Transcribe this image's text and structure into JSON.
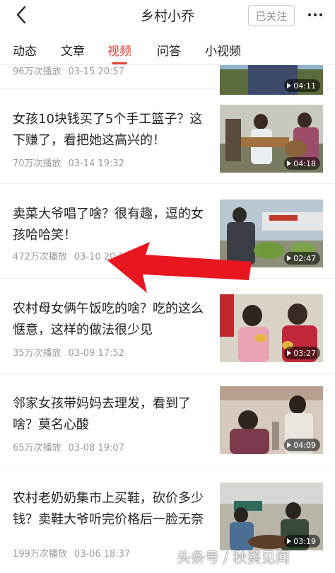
{
  "header": {
    "title": "乡村小乔",
    "follow_label": "已关注"
  },
  "tabs": [
    {
      "label": "动态",
      "active": false
    },
    {
      "label": "文章",
      "active": false
    },
    {
      "label": "视频",
      "active": true
    },
    {
      "label": "问答",
      "active": false
    },
    {
      "label": "小视频",
      "active": false
    }
  ],
  "accent_color": "#e8453c",
  "videos": [
    {
      "title": "",
      "views": "96万次播放",
      "date": "03-15 20:57",
      "duration": "04:11"
    },
    {
      "title": "女孩10块钱买了5个手工篮子？这下赚了，看把她这高兴的！",
      "views": "70万次播放",
      "date": "03-14 19:32",
      "duration": "04:18"
    },
    {
      "title": "卖菜大爷唱了啥？很有趣，逗的女孩哈哈笑！",
      "views": "472万次播放",
      "date": "03-10 20:18",
      "duration": "02:47"
    },
    {
      "title": "农村母女俩午饭吃的啥？吃的这么惬意，这样的做法很少见",
      "views": "35万次播放",
      "date": "03-09 17:52",
      "duration": "03:27"
    },
    {
      "title": "邻家女孩带妈妈去理发，看到了啥？莫名心酸",
      "views": "65万次播放",
      "date": "03-08 19:07",
      "duration": "04:09"
    },
    {
      "title": "农村老奶奶集市上买鞋，砍价多少钱？卖鞋大爷听完价格后一脸无奈",
      "views": "199万次播放",
      "date": "03-06 18:37",
      "duration": "03:19"
    }
  ],
  "watermark": "头条号 / 秋葵见闻"
}
